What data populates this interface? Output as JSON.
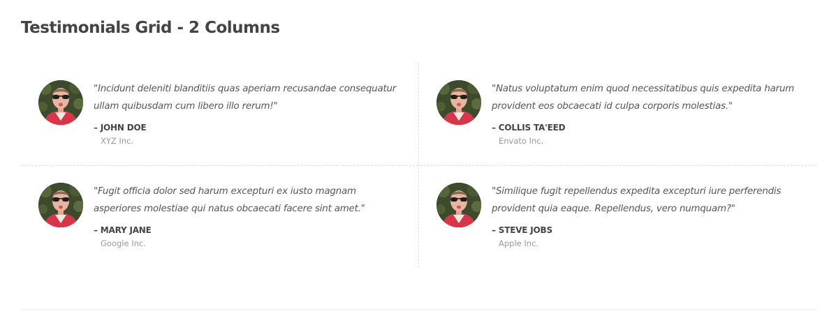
{
  "page": {
    "title": "Testimonials Grid - 2 Columns"
  },
  "testimonials": [
    {
      "quote": "\"Incidunt deleniti blanditiis quas aperiam recusandae consequatur ullam quibusdam cum libero illo rerum!\"",
      "author": "– JOHN DOE",
      "company": "XYZ Inc."
    },
    {
      "quote": "\"Natus voluptatum enim quod necessitatibus quis expedita harum provident eos obcaecati id culpa corporis molestias.\"",
      "author": "– COLLIS TA'EED",
      "company": "Envato Inc."
    },
    {
      "quote": "\"Fugit officia dolor sed harum excepturi ex iusto magnam asperiores molestiae qui natus obcaecati facere sint amet.\"",
      "author": "– MARY JANE",
      "company": "Google Inc."
    },
    {
      "quote": "\"Similique fugit repellendus expedita excepturi iure perferendis provident quia eaque. Repellendus, vero numquam?\"",
      "author": "– STEVE JOBS",
      "company": "Apple Inc."
    }
  ],
  "colors": {
    "heading": "#444444",
    "quote_text": "#555555",
    "company_text": "#999999",
    "divider": "#dcdcdc"
  }
}
